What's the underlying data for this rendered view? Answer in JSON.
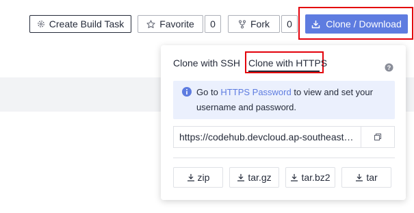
{
  "toolbar": {
    "create_build_task": "Create Build Task",
    "favorite": "Favorite",
    "favorite_count": "0",
    "fork": "Fork",
    "fork_count": "0",
    "clone_download": "Clone / Download"
  },
  "popover": {
    "tabs": [
      "Clone with SSH",
      "Clone with HTTPS"
    ],
    "active_tab": "Clone with HTTPS",
    "info": {
      "prefix": "Go to ",
      "link": "HTTPS Password",
      "suffix": " to view and set your username and password."
    },
    "url": "https://codehub.devcloud.ap-southeast…",
    "downloads": [
      "zip",
      "tar.gz",
      "tar.bz2",
      "tar"
    ]
  },
  "colors": {
    "primary": "#5e7ce0",
    "highlight": "#e3000b",
    "info_bg": "#ebf0fd"
  }
}
